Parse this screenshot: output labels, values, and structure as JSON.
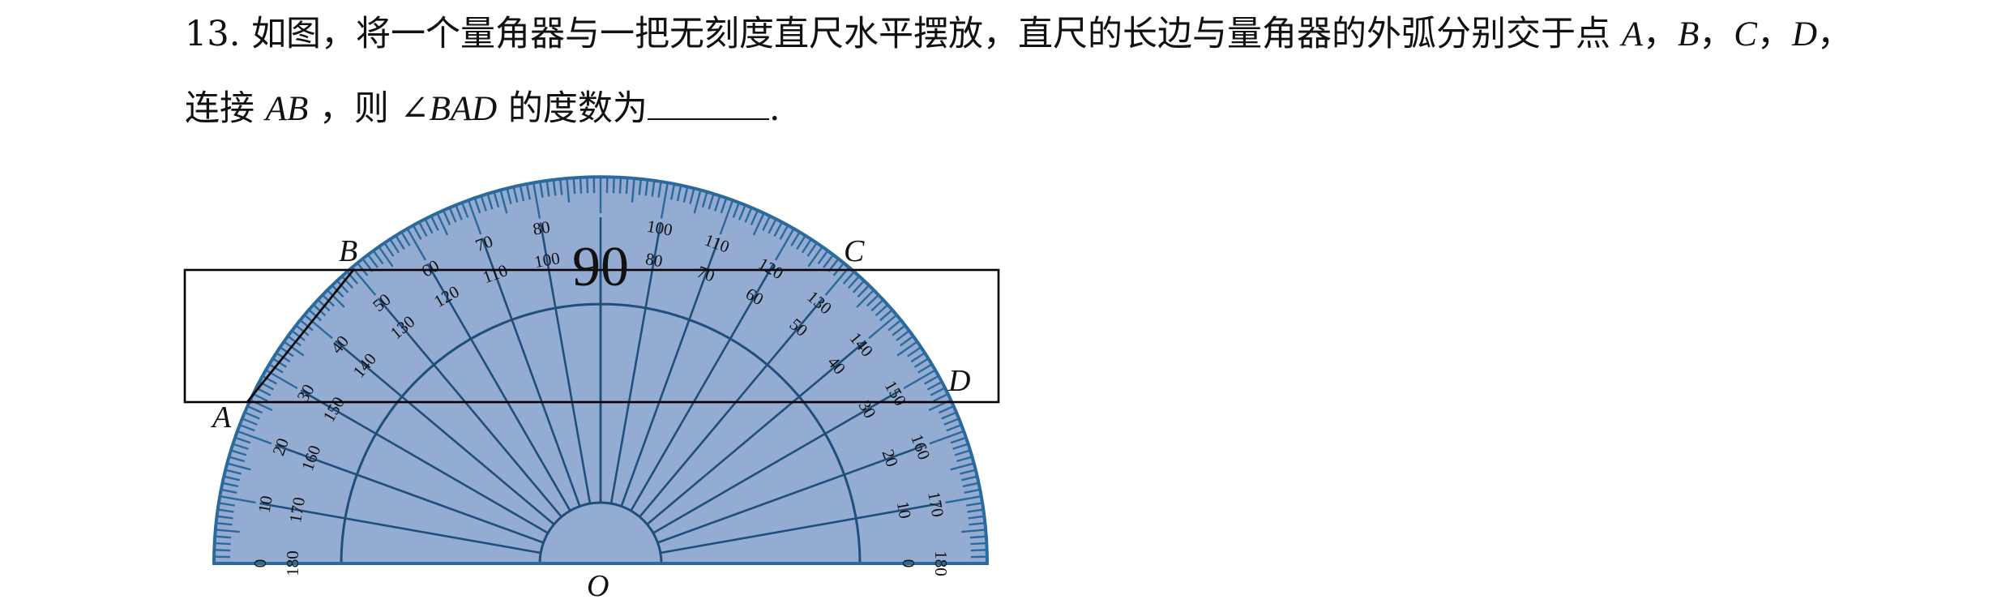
{
  "question": {
    "number": "13.",
    "line1_text": "如图，将一个量角器与一把无刻度直尺水平摆放，直尺的长边与量角器的外弧分别交于点",
    "points_list": [
      "A",
      "B",
      "C",
      "D"
    ],
    "line1_end": "，",
    "line2_prefix": "连接",
    "segment": "AB",
    "line2_mid": "，则",
    "angle_symbol": "∠",
    "angle_name": "BAD",
    "line2_suffix": "的度数为",
    "line2_end": "."
  },
  "figure": {
    "center_label": "O",
    "center_number": "90",
    "point_labels": {
      "A": "A",
      "B": "B",
      "C": "C",
      "D": "D"
    },
    "colors": {
      "protractor_fill": "#94abd2",
      "protractor_stroke": "#2a6a9c",
      "line": "#1f4f7a",
      "ruler": "#000000",
      "text": "#111111"
    }
  }
}
